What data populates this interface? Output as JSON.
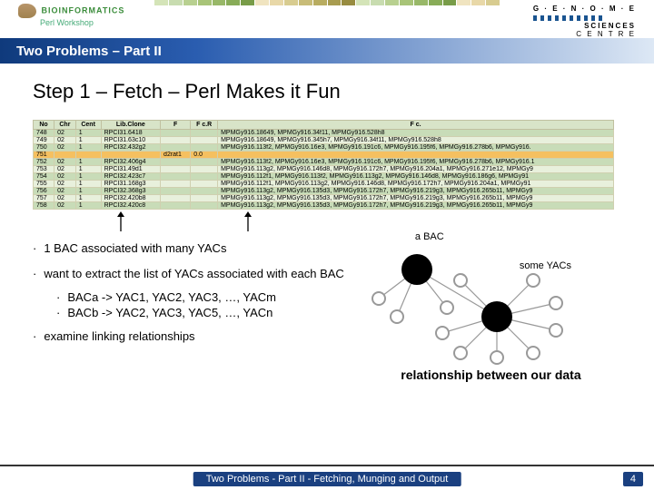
{
  "header": {
    "logo_left_top": "BIOINFORMATICS",
    "logo_left_bottom": "Perl Workshop",
    "logo_right_top": "G · E · N · O · M · E",
    "logo_right_mid": "SCIENCES",
    "logo_right_bot": "C E N T R E"
  },
  "title_bar": "Two Problems – Part II",
  "step_title": "Step 1 – Fetch – Perl Makes it Fun",
  "table": {
    "headers": [
      "No",
      "Chr",
      "Cent",
      "Lib.Clone",
      "F",
      "F c.R",
      "F c."
    ],
    "rows": [
      {
        "hl": false,
        "cells": [
          "748",
          "02",
          "1",
          "RPCI31.6418",
          "",
          "",
          "MPMGy916.18649, MPMGy916.34f11, MPMGy916.528h8"
        ]
      },
      {
        "hl": false,
        "cells": [
          "749",
          "02",
          "1",
          "RPCI31.63c10",
          "",
          "",
          "MPMGy916.18649, MPMGy916.345h7, MPMGy916.34f11, MPMGy916.528h8"
        ]
      },
      {
        "hl": false,
        "cells": [
          "750",
          "02",
          "1",
          "RPCI32.432g2",
          "",
          "",
          "MPMGy916.113f2, MPMGy916.16e3, MPMGy916.191c6, MPMGy916.195f6, MPMGy916.278b6, MPMGy916."
        ]
      },
      {
        "hl": true,
        "cells": [
          "751",
          "",
          "",
          "",
          "d2rat1",
          "0.0",
          ""
        ]
      },
      {
        "hl": false,
        "cells": [
          "752",
          "02",
          "1",
          "RPCI32.406g4",
          "",
          "",
          "MPMGy916.113f2, MPMGy916.16e3, MPMGy916.191c6, MPMGy916.195f6, MPMGy916.278b6, MPMGy916.1"
        ]
      },
      {
        "hl": false,
        "cells": [
          "753",
          "02",
          "1",
          "RPCI31.49d1",
          "",
          "",
          "MPMGy916.113g2, MPMGy916.146d8, MPMGy916.172h7, MPMGy916.204a1, MPMGy916.271e12, MPMGy9"
        ]
      },
      {
        "hl": false,
        "cells": [
          "754",
          "02",
          "1",
          "RPCI32.423c7",
          "",
          "",
          "MPMGy916.112f1, MPMGy916.113f2, MPMGy916.113g2, MPMGy916.146d8, MPMGy916.186g6, MPMGy91"
        ]
      },
      {
        "hl": false,
        "cells": [
          "755",
          "02",
          "1",
          "RPCI31.168g3",
          "",
          "",
          "MPMGy916.112f1, MPMGy916.113g2, MPMGy916.146d8, MPMGy916.172h7, MPMGy916.204a1, MPMGy91"
        ]
      },
      {
        "hl": false,
        "cells": [
          "756",
          "02",
          "1",
          "RPCI32.368g3",
          "",
          "",
          "MPMGy916.113g2, MPMGy916.135d3, MPMGy916.172h7, MPMGy916.219g3, MPMGy916.265b11, MPMGy9"
        ]
      },
      {
        "hl": false,
        "cells": [
          "757",
          "02",
          "1",
          "RPCI32.420b8",
          "",
          "",
          "MPMGy916.113g2, MPMGy916.135d3, MPMGy916.172h7, MPMGy916.219g3, MPMGy916.265b11, MPMGy9"
        ]
      },
      {
        "hl": false,
        "cells": [
          "758",
          "02",
          "1",
          "RPCI32.420c8",
          "",
          "",
          "MPMGy916.113g2, MPMGy916.135d3, MPMGy916.172h7, MPMGy916.219g3, MPMGy916.265b11, MPMGy9"
        ]
      }
    ]
  },
  "bullets": {
    "b1": "1 BAC associated with many YACs",
    "b2": "want to extract the list of YACs associated with each BAC",
    "sub1": "BACa -> YAC1, YAC2, YAC3, …, YACm",
    "sub2": "BACb -> YAC2, YAC3, YAC5, …, YACn",
    "b3": "examine linking relationships"
  },
  "diagram": {
    "lbl_bac": "a BAC",
    "lbl_yacs": "some YACs",
    "caption": "relationship between our data"
  },
  "footer": {
    "text": "Two Problems - Part II - Fetching, Munging and Output",
    "page": "4"
  }
}
